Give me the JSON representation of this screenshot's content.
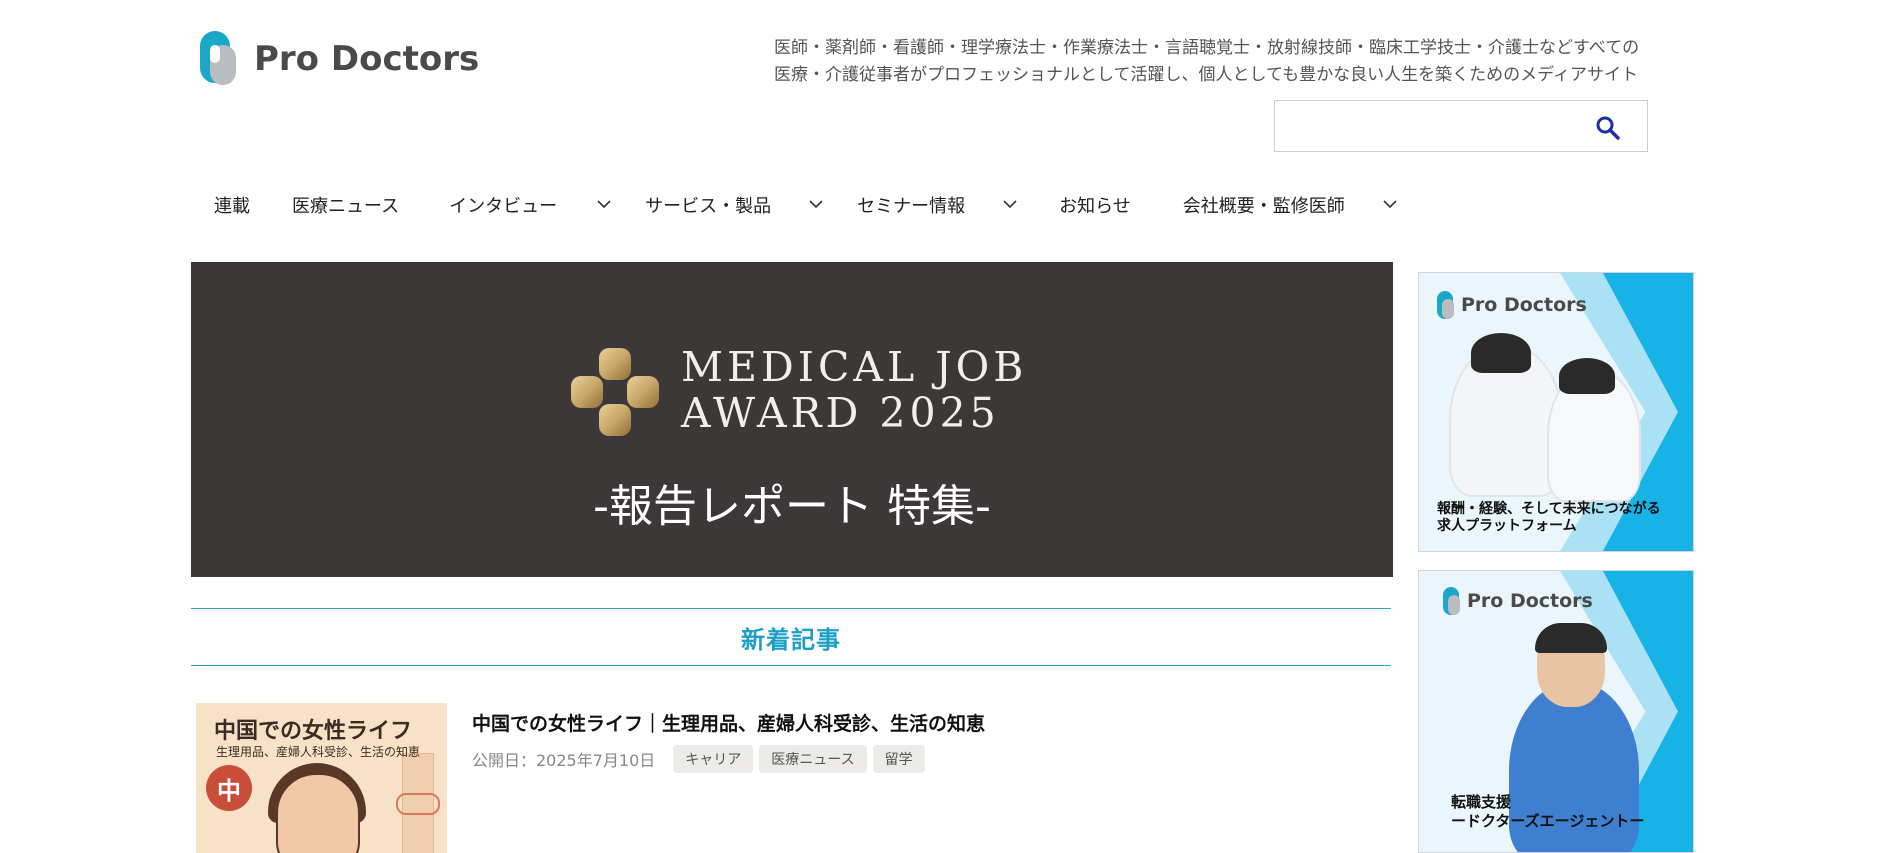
{
  "header": {
    "logo_text": "Pro Doctors",
    "tagline_line1": "医師・薬剤師・看護師・理学療法士・作業療法士・言語聴覚士・放射線技師・臨床工学技士・介護士などすべての",
    "tagline_line2": "医療・介護従事者がプロフェッショナルとして活躍し、個人としても豊かな良い人生を築くためのメディアサイト",
    "search": {
      "placeholder": "",
      "value": "",
      "button_icon": "search-icon"
    }
  },
  "nav": {
    "items": [
      {
        "label": "連載",
        "has_dropdown": false
      },
      {
        "label": "医療ニュース",
        "has_dropdown": false
      },
      {
        "label": "インタビュー",
        "has_dropdown": true
      },
      {
        "label": "サービス・製品",
        "has_dropdown": true
      },
      {
        "label": "セミナー情報",
        "has_dropdown": true
      },
      {
        "label": "お知らせ",
        "has_dropdown": false
      },
      {
        "label": "会社概要・監修医師",
        "has_dropdown": true
      }
    ]
  },
  "hero": {
    "title_line1": "MEDICAL JOB",
    "title_line2": "AWARD 2025",
    "subtitle": "-報告レポート 特集-",
    "background_color": "#3d3838",
    "emblem_color": "#c9a86a"
  },
  "section": {
    "heading": "新着記事",
    "accent_color": "#1ea0c6"
  },
  "articles": [
    {
      "title": "中国での女性ライフ｜生理用品、産婦人科受診、生活の知恵",
      "date": "公開日：2025年7月10日",
      "tags": [
        "キャリア",
        "医療ニュース",
        "留学"
      ],
      "thumbnail": {
        "headline": "中国での女性ライフ",
        "subline": "生理用品、産婦人科受診、生活の知恵",
        "badge": "中"
      }
    }
  ],
  "sidebar": {
    "ads": [
      {
        "brand": "Pro Doctors",
        "caption_line1": "報酬・経験、そして未来につながる",
        "caption_line2": "求人プラットフォーム"
      },
      {
        "brand": "Pro Doctors",
        "caption_line1": "転職支援",
        "caption_line2": "ードクターズエージェントー"
      }
    ]
  }
}
